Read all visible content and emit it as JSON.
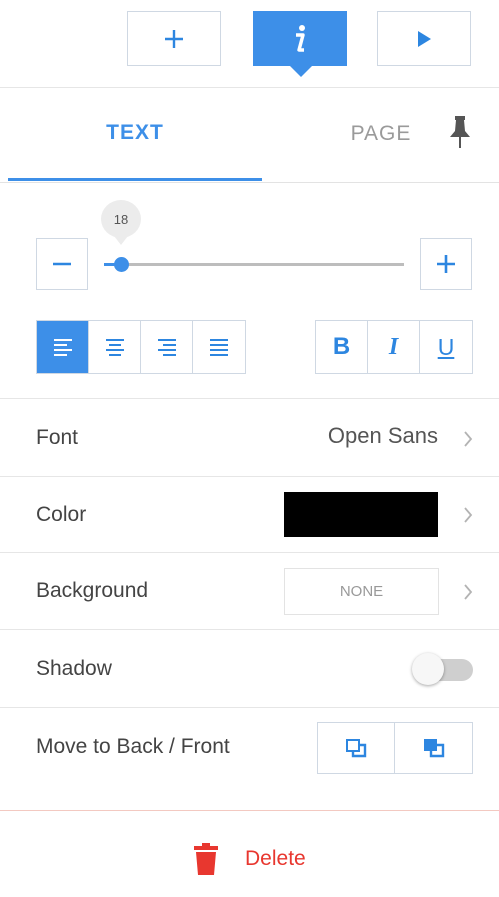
{
  "toolbar": {
    "add_icon": "plus-icon",
    "info_icon": "info-icon",
    "play_icon": "play-icon",
    "accent_color": "#3d8fe8"
  },
  "tabs": {
    "items": [
      {
        "label": "TEXT",
        "active": true
      },
      {
        "label": "PAGE",
        "active": false
      }
    ],
    "pin_icon": "pin-icon"
  },
  "font_size": {
    "value": "18",
    "fraction": 0.06
  },
  "alignment": {
    "options": [
      "align-left",
      "align-center",
      "align-right",
      "justify"
    ],
    "selected": "align-left"
  },
  "text_style": {
    "bold": "B",
    "italic": "I",
    "underline": "U"
  },
  "font": {
    "label": "Font",
    "value": "Open Sans"
  },
  "color": {
    "label": "Color",
    "value": "#000000"
  },
  "background": {
    "label": "Background",
    "value": "NONE"
  },
  "shadow": {
    "label": "Shadow",
    "enabled": false
  },
  "arrange": {
    "label": "Move to Back / Front",
    "back_icon": "send-to-back-icon",
    "front_icon": "bring-to-front-icon"
  },
  "delete": {
    "label": "Delete",
    "icon": "trash-icon",
    "color": "#e8372f"
  }
}
